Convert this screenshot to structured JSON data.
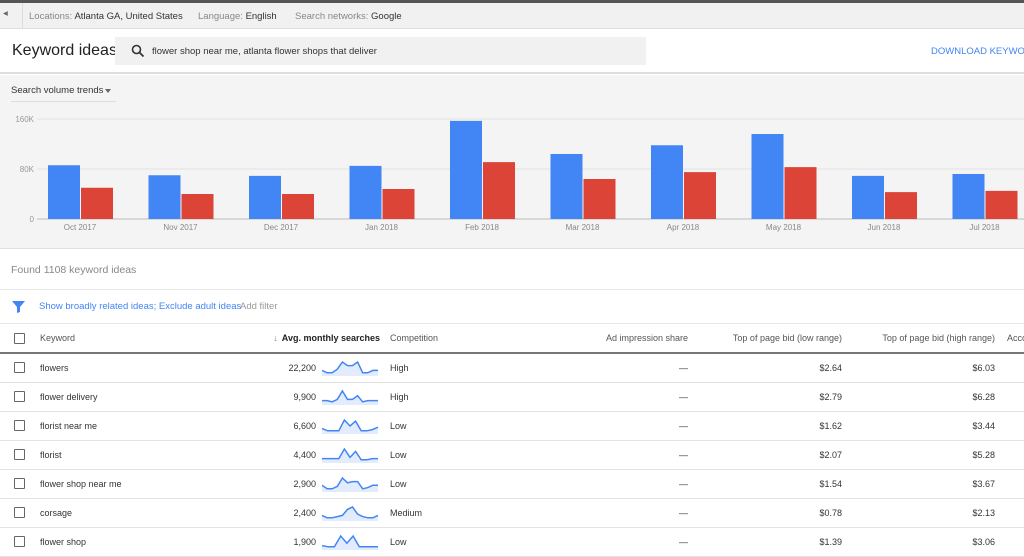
{
  "topbar": {
    "locations_label": "Locations:",
    "locations": "Atlanta GA, United States",
    "language_label": "Language:",
    "language": "English",
    "networks_label": "Search networks:",
    "networks": "Google"
  },
  "header": {
    "title": "Keyword ideas",
    "search_value": "flower shop near me, atlanta flower shops that deliver",
    "download": "DOWNLOAD KEYWORD"
  },
  "trend_select": "Search volume trends",
  "colors": {
    "blue": "#4285f4",
    "red": "#db4437",
    "link": "#4285f4"
  },
  "chart_data": {
    "type": "bar",
    "categories": [
      "Oct 2017",
      "Nov 2017",
      "Dec 2017",
      "Jan 2018",
      "Feb 2018",
      "Mar 2018",
      "Apr 2018",
      "May 2018",
      "Jun 2018",
      "Jul 2018"
    ],
    "series": [
      {
        "values": [
          86000,
          70000,
          69000,
          85000,
          157000,
          104000,
          118000,
          136000,
          69000,
          72000
        ],
        "color": "#4285f4"
      },
      {
        "values": [
          50000,
          40000,
          40000,
          48000,
          91000,
          64000,
          75000,
          83000,
          43000,
          45000
        ],
        "color": "#db4437"
      }
    ],
    "yticks": [
      "0",
      "80K",
      "160K"
    ],
    "ylim": [
      0,
      160000
    ],
    "grid": true
  },
  "found": "Found 1108 keyword ideas",
  "filter": {
    "applied": "Show broadly related ideas; Exclude adult ideas",
    "add": "Add filter"
  },
  "table": {
    "columns": {
      "keyword": "Keyword",
      "avg": "Avg. monthly searches",
      "competition": "Competition",
      "impr": "Ad impression share",
      "low": "Top of page bid (low range)",
      "high": "Top of page bid (high range)",
      "acc": "Acco"
    },
    "rows": [
      {
        "keyword": "flowers",
        "avg": "22,200",
        "competition": "High",
        "impr": "—",
        "low": "$2.64",
        "high": "$6.03",
        "trend": [
          0.3,
          0.1,
          0.1,
          0.4,
          1,
          0.7,
          0.7,
          1,
          0.1,
          0.1,
          0.3,
          0.3
        ]
      },
      {
        "keyword": "flower delivery",
        "avg": "9,900",
        "competition": "High",
        "impr": "—",
        "low": "$2.79",
        "high": "$6.28",
        "trend": [
          0.2,
          0.2,
          0.1,
          0.3,
          1,
          0.3,
          0.3,
          0.6,
          0.1,
          0.2,
          0.2,
          0.2
        ]
      },
      {
        "keyword": "florist near me",
        "avg": "6,600",
        "competition": "Low",
        "impr": "—",
        "low": "$1.62",
        "high": "$3.44",
        "trend": [
          0.3,
          0.1,
          0.1,
          0.1,
          1,
          0.5,
          0.9,
          0.1,
          0.1,
          0.2,
          0.4
        ]
      },
      {
        "keyword": "florist",
        "avg": "4,400",
        "competition": "Low",
        "impr": "—",
        "low": "$2.07",
        "high": "$5.28",
        "trend": [
          0.2,
          0.2,
          0.2,
          0.2,
          1,
          0.3,
          0.8,
          0.1,
          0.1,
          0.2,
          0.2
        ]
      },
      {
        "keyword": "flower shop near me",
        "avg": "2,900",
        "competition": "Low",
        "impr": "—",
        "low": "$1.54",
        "high": "$3.67",
        "trend": [
          0.4,
          0.1,
          0.1,
          0.3,
          1,
          0.6,
          0.7,
          0.7,
          0.1,
          0.2,
          0.4,
          0.4
        ]
      },
      {
        "keyword": "corsage",
        "avg": "2,400",
        "competition": "Medium",
        "impr": "—",
        "low": "$0.78",
        "high": "$2.13",
        "trend": [
          0.3,
          0.1,
          0.1,
          0.2,
          0.3,
          0.8,
          1,
          0.4,
          0.2,
          0.1,
          0.1,
          0.3
        ]
      },
      {
        "keyword": "flower shop",
        "avg": "1,900",
        "competition": "Low",
        "impr": "—",
        "low": "$1.39",
        "high": "$3.06",
        "trend": [
          0.2,
          0.1,
          0.1,
          1,
          0.4,
          1,
          0.1,
          0.1,
          0.1,
          0.1
        ]
      }
    ]
  }
}
